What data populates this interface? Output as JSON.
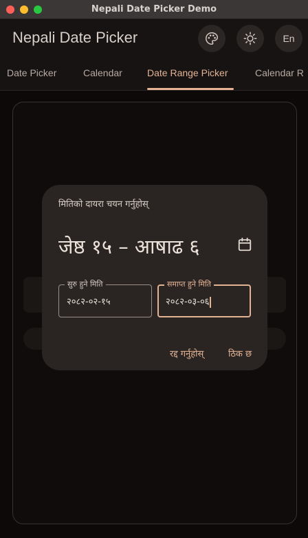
{
  "window": {
    "title": "Nepali Date Picker Demo"
  },
  "appbar": {
    "title": "Nepali Date Picker",
    "palette_icon": "palette-icon",
    "theme_icon": "brightness-icon",
    "language_label": "En"
  },
  "tabs": [
    {
      "label": "Date Picker"
    },
    {
      "label": "Calendar"
    },
    {
      "label": "Date Range Picker",
      "selected": true
    },
    {
      "label": "Calendar R"
    }
  ],
  "dialog": {
    "heading": "मितिको दायरा चयन गर्नुहोस्",
    "range_text": "जेष्ठ १५ – आषाढ ६",
    "calendar_icon": "calendar-icon",
    "start_field": {
      "label": "सुरु हुने मिति",
      "value": "२०८२-०२-१५"
    },
    "end_field": {
      "label": "समाप्त हुने मिति",
      "value": "२०८२-०३-०६"
    },
    "cancel_label": "रद्द गर्नुहोस्",
    "ok_label": "ठिक छ"
  },
  "colors": {
    "accent": "#e3b394",
    "surface": "#2a2523",
    "background": "#0c0908"
  }
}
